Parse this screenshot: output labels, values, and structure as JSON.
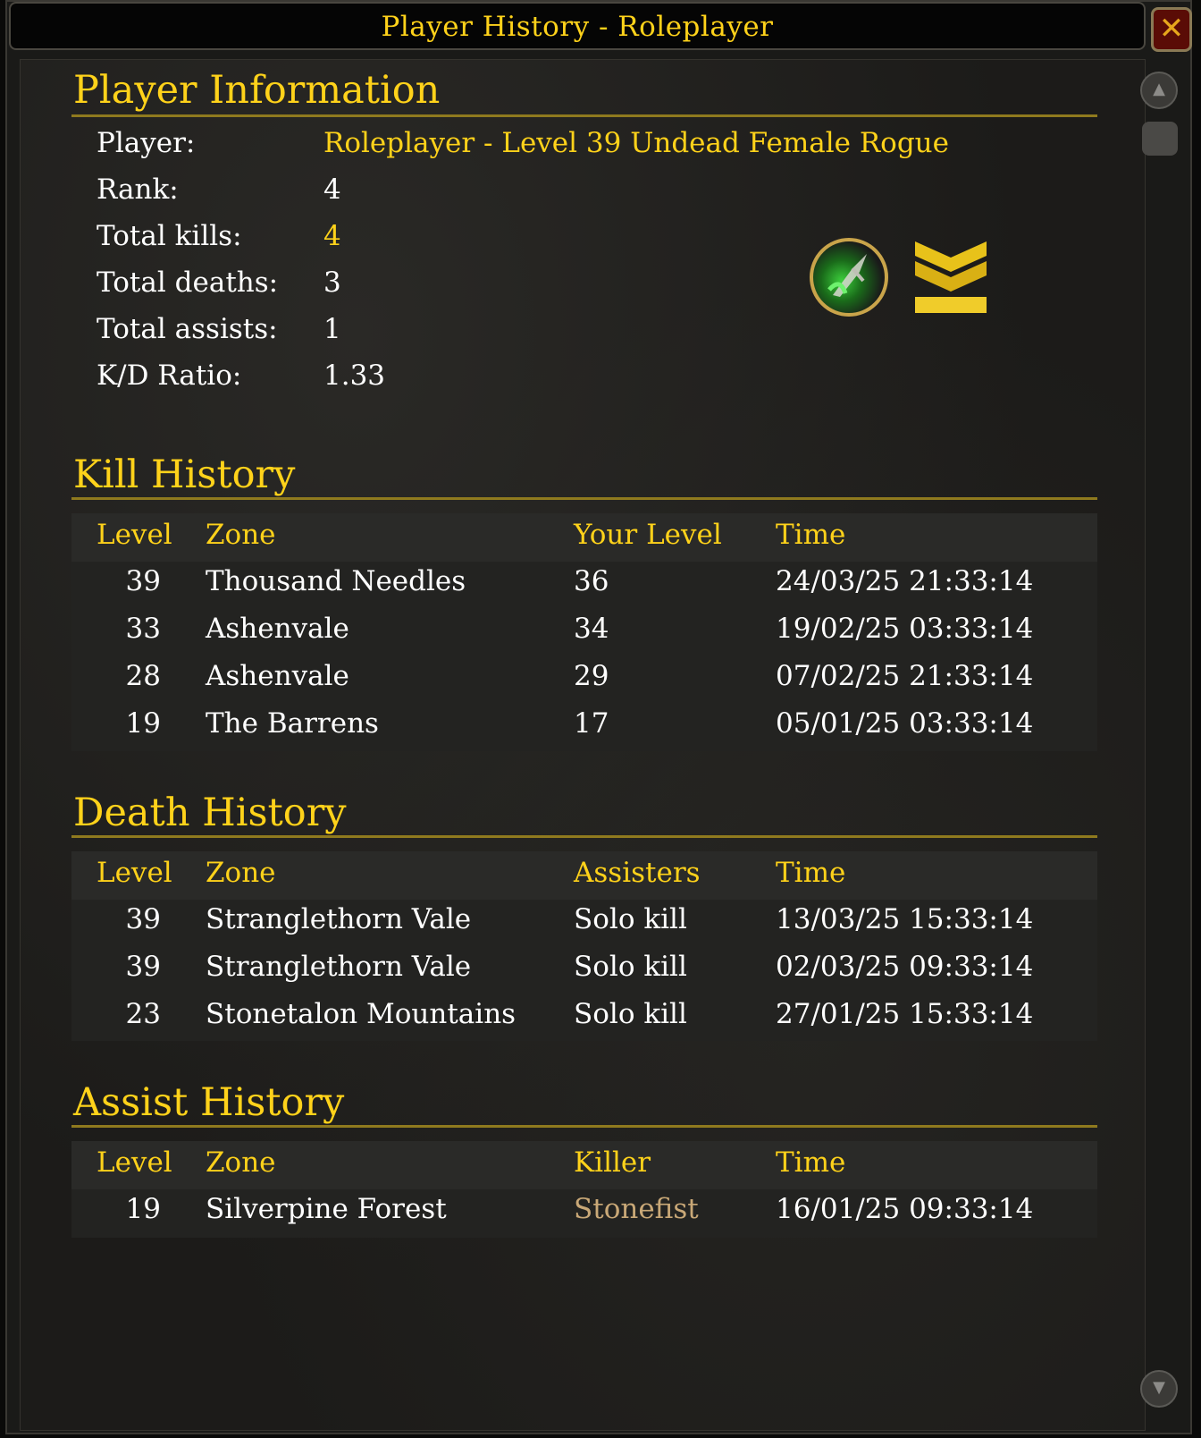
{
  "window": {
    "title": "Player History - Roleplayer",
    "close_label": "✕"
  },
  "player_info": {
    "heading": "Player Information",
    "fields": [
      {
        "label": "Player:",
        "value": "Roleplayer - Level 39 Undead Female Rogue"
      },
      {
        "label": "Rank:",
        "value": "4"
      },
      {
        "label": "Total kills:",
        "value": "4"
      },
      {
        "label": "Total deaths:",
        "value": "3"
      },
      {
        "label": "Total assists:",
        "value": "1"
      },
      {
        "label": "K/D Ratio:",
        "value": "1.33"
      }
    ],
    "icons": [
      "rogue-spell-icon",
      "rank-chevron-icon"
    ]
  },
  "kill_history": {
    "heading": "Kill History",
    "columns": [
      "Level",
      "Zone",
      "Your Level",
      "Time"
    ],
    "rows": [
      [
        "39",
        "Thousand Needles",
        "36",
        "24/03/25 21:33:14"
      ],
      [
        "33",
        "Ashenvale",
        "34",
        "19/02/25 03:33:14"
      ],
      [
        "28",
        "Ashenvale",
        "29",
        "07/02/25 21:33:14"
      ],
      [
        "19",
        "The Barrens",
        "17",
        "05/01/25 03:33:14"
      ]
    ]
  },
  "death_history": {
    "heading": "Death History",
    "columns": [
      "Level",
      "Zone",
      "Assisters",
      "Time"
    ],
    "rows": [
      [
        "39",
        "Stranglethorn Vale",
        "Solo kill",
        "13/03/25 15:33:14"
      ],
      [
        "39",
        "Stranglethorn Vale",
        "Solo kill",
        "02/03/25 09:33:14"
      ],
      [
        "23",
        "Stonetalon Mountains",
        "Solo kill",
        "27/01/25 15:33:14"
      ]
    ]
  },
  "assist_history": {
    "heading": "Assist History",
    "columns": [
      "Level",
      "Zone",
      "Killer",
      "Time"
    ],
    "rows": [
      [
        "19",
        "Silverpine Forest",
        "Stonefist",
        "16/01/25 09:33:14"
      ]
    ]
  },
  "colors": {
    "gold": "#ffd21a",
    "killer_name": "#c9a877",
    "background": "#1c1b19"
  }
}
